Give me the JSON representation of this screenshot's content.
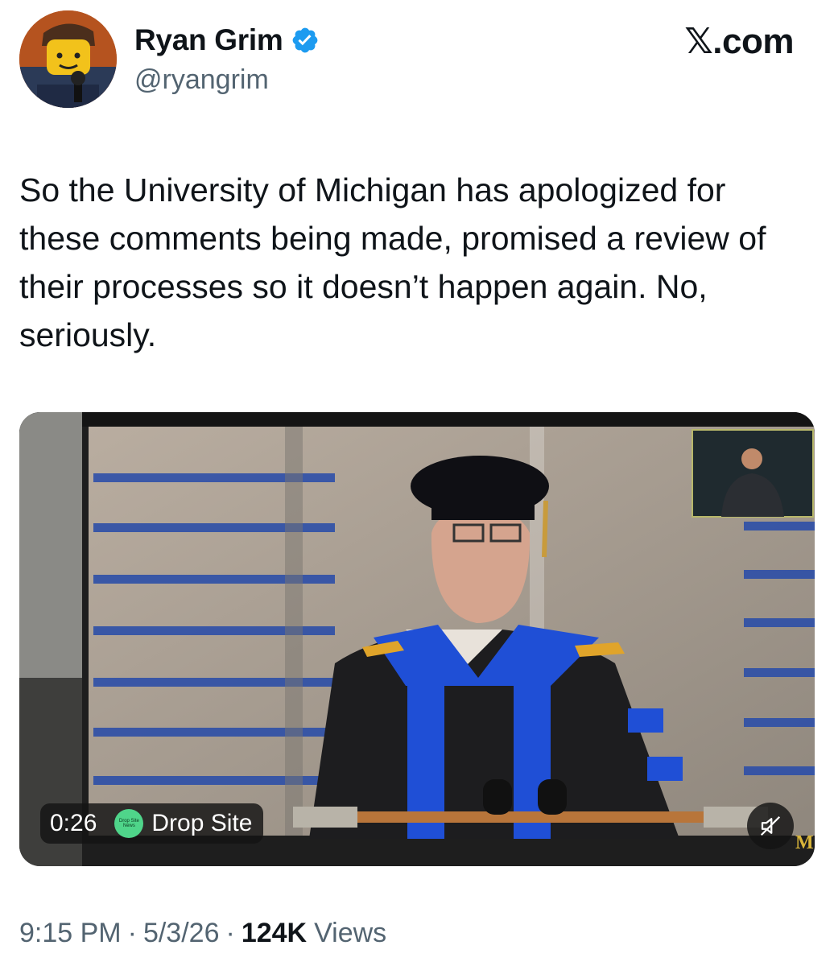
{
  "author": {
    "display_name": "Ryan Grim",
    "handle": "@ryangrim",
    "verified_icon": "verified-badge-icon",
    "avatar_icon": "lego-minifigure-avatar"
  },
  "brand": "𝕏.com",
  "tweet": {
    "text": "So the University of Michigan has apologized for these comments being made, promised a review of their processes so it doesn’t happen again. No, seriously."
  },
  "video": {
    "elapsed": "0:26",
    "channel_name": "Drop Site",
    "channel_logo_text": "Drop Site News",
    "mute_icon": "speaker-muted-icon",
    "corner_mark": "M"
  },
  "meta": {
    "time": "9:15 PM",
    "separator": "·",
    "date": "5/3/26",
    "views_count": "124K",
    "views_label": "Views"
  },
  "colors": {
    "verified_blue": "#1d9bf0",
    "text_primary": "#0f1419",
    "text_secondary": "#536471",
    "gown_blue": "#1f4fd6",
    "stadium_stripe": "#2d4fa8",
    "logo_green": "#4fd58a"
  }
}
